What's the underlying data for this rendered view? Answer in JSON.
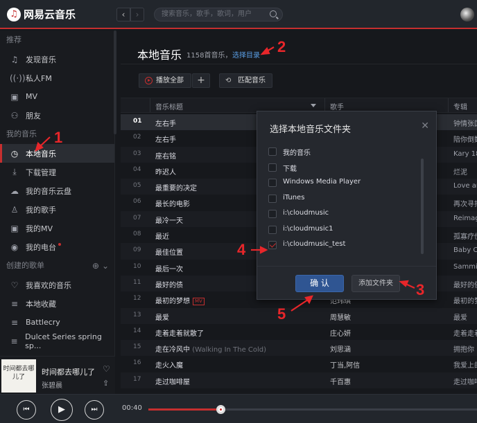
{
  "app": {
    "logo_text": "网易云音乐",
    "logo_icon": "netease-cloud-music-icon"
  },
  "search": {
    "placeholder": "搜索音乐，歌手，歌词，用户"
  },
  "sidebar": {
    "recommend_title": "推荐",
    "recommend_items": [
      {
        "label": "发现音乐",
        "icon": "music-note-icon"
      },
      {
        "label": "私人FM",
        "icon": "radio-icon"
      },
      {
        "label": "MV",
        "icon": "mv-icon"
      },
      {
        "label": "朋友",
        "icon": "friends-icon"
      }
    ],
    "my_music_title": "我的音乐",
    "my_music_items": [
      {
        "label": "本地音乐",
        "icon": "clock-icon",
        "active": true
      },
      {
        "label": "下载管理",
        "icon": "download-icon"
      },
      {
        "label": "我的音乐云盘",
        "icon": "cloud-icon"
      },
      {
        "label": "我的歌手",
        "icon": "singer-icon"
      },
      {
        "label": "我的MV",
        "icon": "mv-icon"
      },
      {
        "label": "我的电台",
        "icon": "podcast-icon",
        "dot": true
      }
    ],
    "playlists_title": "创建的歌单",
    "playlists": [
      {
        "label": "我喜欢的音乐",
        "icon": "heart-icon"
      },
      {
        "label": "本地收藏",
        "icon": "playlist-icon"
      },
      {
        "label": "Battlecry",
        "icon": "playlist-icon"
      },
      {
        "label": "Dulcet Series spring sp...",
        "icon": "playlist-icon"
      }
    ]
  },
  "now_playing": {
    "title": "时间都去哪儿了",
    "artist": "张碧晨",
    "cover_text": "时间都去哪儿了"
  },
  "player": {
    "current_time": "00:40",
    "progress": 0.22
  },
  "main": {
    "title": "本地音乐",
    "count": "1158首音乐，",
    "choose_dir": "选择目录",
    "play_all": "播放全部",
    "add": "+",
    "match": "匹配音乐",
    "columns": {
      "title": "音乐标题",
      "artist": "歌手",
      "album": "专辑"
    },
    "rows": [
      {
        "idx": "01",
        "title": "左右手",
        "alias": "",
        "mv": false,
        "artist": "",
        "album": "钟情张国荣"
      },
      {
        "idx": "02",
        "title": "左右手",
        "alias": "",
        "mv": false,
        "artist": "",
        "album": "陪你倒数"
      },
      {
        "idx": "03",
        "title": "座右铭",
        "alias": "",
        "mv": false,
        "artist": "",
        "album": "Kary 18"
      },
      {
        "idx": "04",
        "title": "昨迟人",
        "alias": "",
        "mv": false,
        "artist": "",
        "album": "烂泥"
      },
      {
        "idx": "05",
        "title": "最重要的决定",
        "alias": "",
        "mv": false,
        "artist": "",
        "album": "Love and"
      },
      {
        "idx": "06",
        "title": "最长的电影",
        "alias": "",
        "mv": false,
        "artist": "",
        "album": "再次寻找"
      },
      {
        "idx": "07",
        "title": "最冷一天",
        "alias": "",
        "mv": false,
        "artist": "",
        "album": "Reimagin"
      },
      {
        "idx": "08",
        "title": "最近",
        "alias": "",
        "mv": false,
        "artist": "",
        "album": "孤寡疗伤"
      },
      {
        "idx": "09",
        "title": "最佳位置",
        "alias": "",
        "mv": false,
        "artist": "",
        "album": "Baby Co"
      },
      {
        "idx": "10",
        "title": "最后一次",
        "alias": "",
        "mv": false,
        "artist": "",
        "album": "Sammi"
      },
      {
        "idx": "11",
        "title": "最好的债",
        "alias": "",
        "mv": false,
        "artist": "",
        "album": "最好的债"
      },
      {
        "idx": "12",
        "title": "最初的梦想",
        "alias": "",
        "mv": true,
        "artist": "范玮琪",
        "album": "最初的梦"
      },
      {
        "idx": "13",
        "title": "最爱",
        "alias": "",
        "mv": false,
        "artist": "周慧敏",
        "album": "最爱"
      },
      {
        "idx": "14",
        "title": "走着走着就散了",
        "alias": "",
        "mv": false,
        "artist": "庄心妍",
        "album": "走着走着"
      },
      {
        "idx": "15",
        "title": "走在冷风中",
        "alias": "(Walking In The Cold)",
        "mv": false,
        "artist": "刘思涵",
        "album": "拥抱你"
      },
      {
        "idx": "16",
        "title": "走火入魔",
        "alias": "",
        "mv": false,
        "artist": "丁当,阿信",
        "album": "我爱上的"
      },
      {
        "idx": "17",
        "title": "走过咖啡屋",
        "alias": "",
        "mv": false,
        "artist": "千百惠",
        "album": "走过咖啡"
      }
    ]
  },
  "dialog": {
    "title": "选择本地音乐文件夹",
    "folders": [
      {
        "label": "我的音乐",
        "checked": false
      },
      {
        "label": "下载",
        "checked": false
      },
      {
        "label": "Windows Media Player",
        "checked": false
      },
      {
        "label": "iTunes",
        "checked": false
      },
      {
        "label": "i:\\cloudmusic",
        "checked": false
      },
      {
        "label": "i:\\cloudmusic1",
        "checked": false
      },
      {
        "label": "i:\\cloudmusic_test",
        "checked": true
      }
    ],
    "confirm": "确 认",
    "add_folder": "添加文件夹"
  },
  "annotations": [
    "1",
    "2",
    "3",
    "4",
    "5"
  ],
  "colors": {
    "accent": "#c62f2f",
    "link": "#5a9fe6",
    "confirm": "#2f5592",
    "annotation": "#e8262a"
  }
}
